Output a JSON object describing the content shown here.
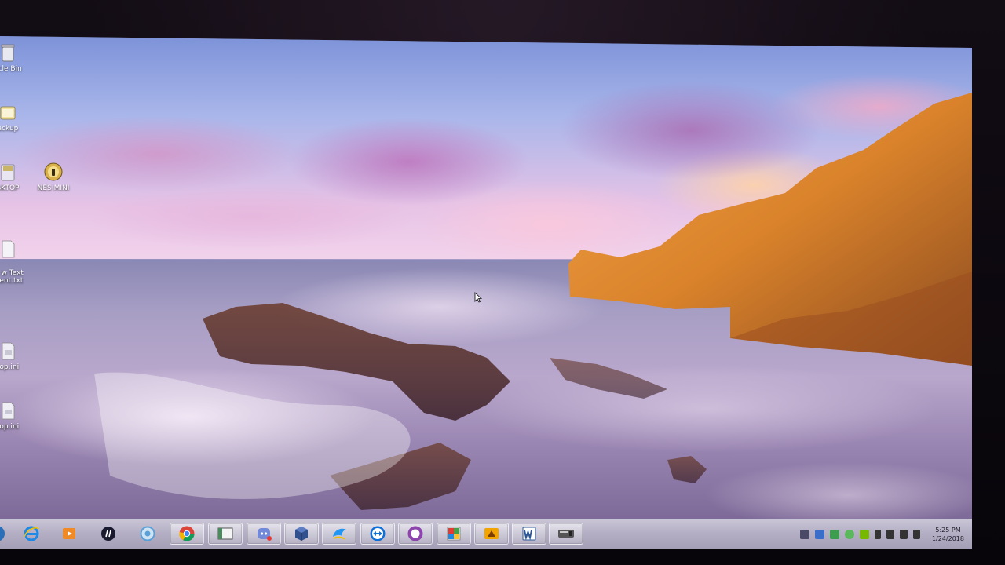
{
  "desktop": {
    "icons": [
      {
        "name": "recycle-bin",
        "label": "ycle Bin"
      },
      {
        "name": "backup-folder",
        "label": "ackup"
      },
      {
        "name": "desktop-shortcut",
        "label": "SKTOP"
      },
      {
        "name": "nes-mini",
        "label": "NES MINI"
      },
      {
        "name": "text-document",
        "label": "w Text\nment.txt"
      },
      {
        "name": "desktop-ini-1",
        "label": "top.ini"
      },
      {
        "name": "desktop-ini-2",
        "label": "top.ini"
      }
    ]
  },
  "taskbar": {
    "pinned": [
      {
        "name": "internet-explorer",
        "icon": "ie-icon",
        "color": "#1e88e5"
      },
      {
        "name": "media-player",
        "icon": "media-player-icon",
        "color": "#f08a24"
      },
      {
        "name": "hp",
        "icon": "hp-icon",
        "color": "#1a1a2e"
      },
      {
        "name": "browser-app",
        "icon": "globe-icon",
        "color": "#5aa0d8"
      },
      {
        "name": "chrome",
        "icon": "chrome-icon",
        "color": "#db4437"
      },
      {
        "name": "window-app",
        "icon": "window-icon",
        "color": "#4a8a5c"
      },
      {
        "name": "discord",
        "icon": "discord-icon",
        "color": "#7289da"
      },
      {
        "name": "virtualbox",
        "icon": "cube-icon",
        "color": "#2f4f8f"
      },
      {
        "name": "dolphin",
        "icon": "dolphin-icon",
        "color": "#2196f3"
      },
      {
        "name": "teamviewer",
        "icon": "teamviewer-icon",
        "color": "#0e6fd8"
      },
      {
        "name": "purple-app",
        "icon": "circle-app-icon",
        "color": "#8e44ad"
      },
      {
        "name": "gallery-app",
        "icon": "gallery-icon",
        "color": "#e53935"
      },
      {
        "name": "game-app",
        "icon": "game-icon",
        "color": "#f2a500"
      },
      {
        "name": "word",
        "icon": "word-icon",
        "color": "#2b579a"
      },
      {
        "name": "console-app",
        "icon": "console-icon",
        "color": "#555555"
      }
    ],
    "tray_icons": [
      "discord-tray-icon",
      "dropbox-tray-icon",
      "sync-tray-icon",
      "update-tray-icon",
      "nvidia-tray-icon",
      "battery-icon",
      "volume-icon",
      "network-icon",
      "flag-icon"
    ],
    "clock": {
      "time": "5:25 PM",
      "date": "1/24/2018"
    }
  },
  "colors": {
    "taskbar": "#b4afc4",
    "cliff": "#d9822b"
  }
}
